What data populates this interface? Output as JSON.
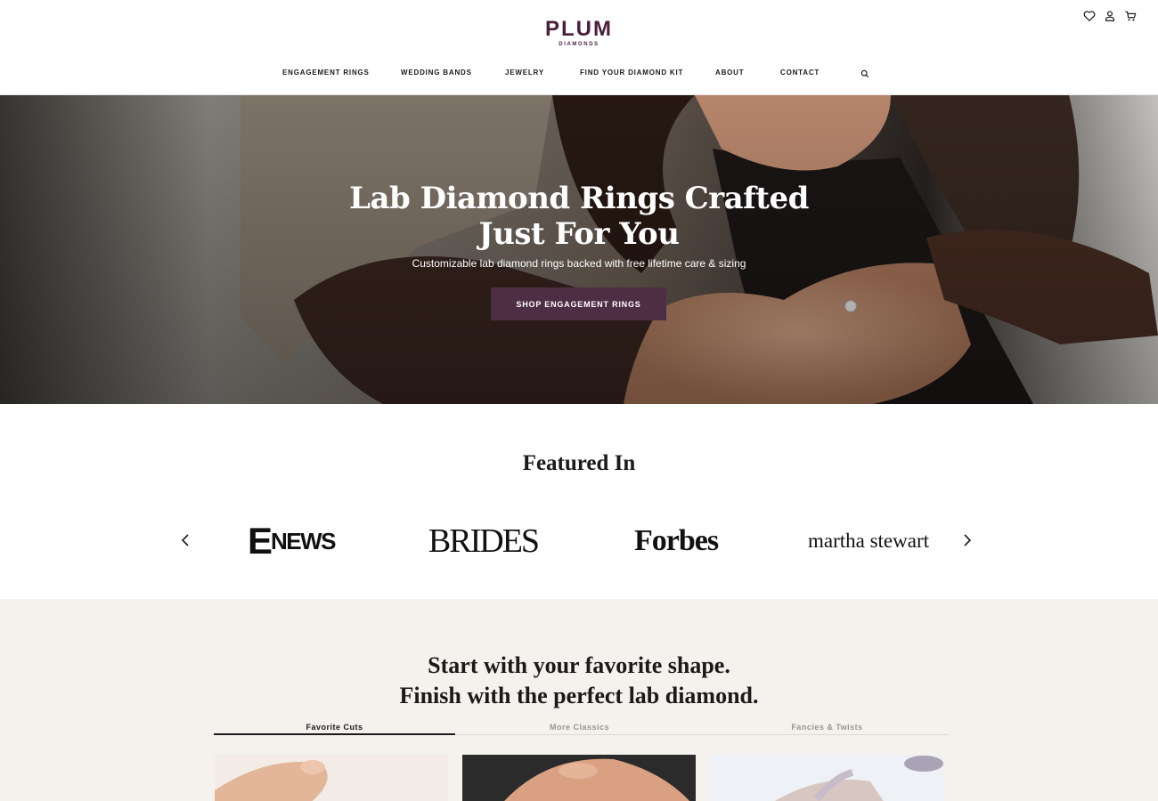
{
  "brand": {
    "name": "PLUM",
    "tagline": "DIAMONDS",
    "color": "#4a1f3e"
  },
  "utility_icons": [
    "heart-icon",
    "user-icon",
    "cart-icon"
  ],
  "nav": {
    "items": [
      "ENGAGEMENT RINGS",
      "WEDDING BANDS",
      "JEWELRY",
      "FIND YOUR DIAMOND KIT",
      "ABOUT",
      "CONTACT"
    ],
    "search_icon": "search-icon"
  },
  "hero": {
    "title": "Lab Diamond Rings Crafted Just For You",
    "subtitle": "Customizable lab diamond rings backed with free lifetime care & sizing",
    "cta": "SHOP ENGAGEMENT RINGS",
    "cta_color": "#4e2e45"
  },
  "featured": {
    "title": "Featured In",
    "logos": {
      "enews_e": "E",
      "enews_rest": "NEWS",
      "brides": "BRIDES",
      "forbes": "Forbes",
      "martha": "martha stewart"
    },
    "prev_icon": "chevron-left-icon",
    "next_icon": "chevron-right-icon"
  },
  "shapes": {
    "title_line1": "Start with your favorite shape.",
    "title_line2": "Finish with the perfect lab diamond.",
    "tabs": [
      "Favorite Cuts",
      "More Classics",
      "Fancies & Twists"
    ],
    "active_tab": "Favorite Cuts",
    "background": "#f5f2ee"
  }
}
